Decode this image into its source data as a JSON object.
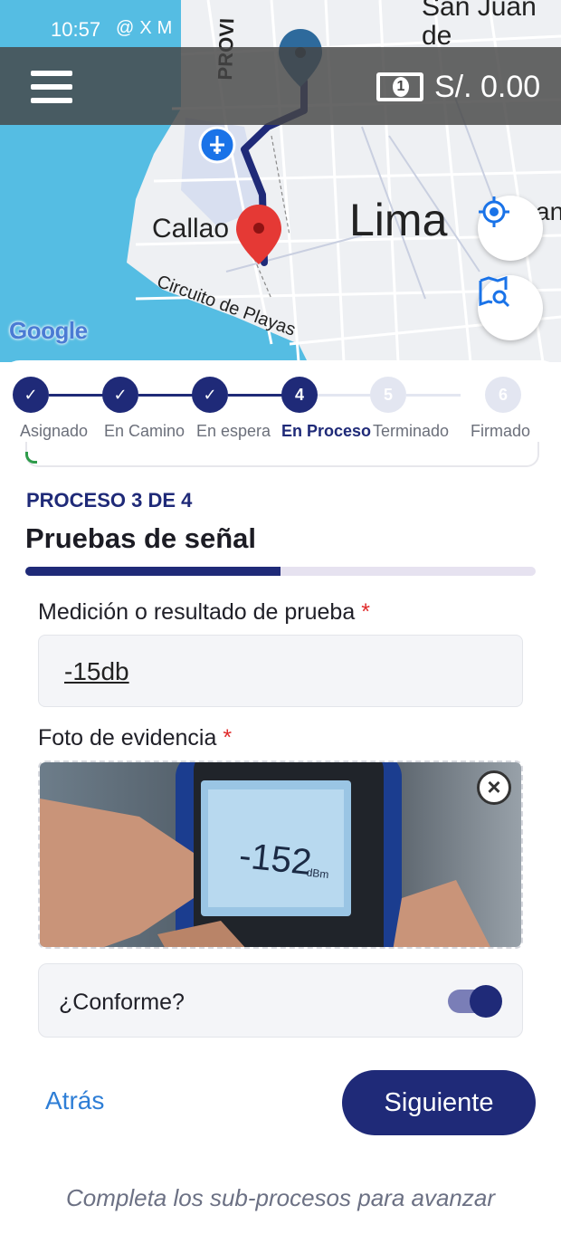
{
  "status_bar": {
    "time": "10:57",
    "icons": [
      "threads-icon",
      "x-icon",
      "gmail-icon"
    ]
  },
  "header": {
    "menu_icon": "hamburger-menu-icon",
    "balance": "S/. 0.00",
    "balance_icon": "banknote-icon"
  },
  "map": {
    "labels": {
      "city": "Lima",
      "port": "Callao",
      "road": "Circuito de Playas",
      "district_top": "San Juan de Lurigancho",
      "street_top": "PROVI",
      "right_edge": "an"
    },
    "attribution": "Google",
    "markers": [
      "origin-pin",
      "destination-pin",
      "airport-marker"
    ],
    "controls": [
      "my-location-button",
      "map-search-button"
    ]
  },
  "stepper": {
    "current": 4,
    "steps": [
      {
        "number": "1",
        "label": "Asignado",
        "state": "done"
      },
      {
        "number": "2",
        "label": "En Camino",
        "state": "done"
      },
      {
        "number": "3",
        "label": "En espera",
        "state": "done"
      },
      {
        "number": "4",
        "label": "En Proceso",
        "state": "active"
      },
      {
        "number": "5",
        "label": "Terminado",
        "state": "todo"
      },
      {
        "number": "6",
        "label": "Firmado",
        "state": "todo"
      }
    ]
  },
  "process": {
    "counter": "PROCESO 3 DE 4",
    "title": "Pruebas de señal",
    "progress_fraction": 0.5
  },
  "form": {
    "measure_label": "Medición o resultado de prueba",
    "measure_required": "*",
    "measure_value": "-15db",
    "photo_label": "Foto de evidencia",
    "photo_required": "*",
    "photo_reading": "-152",
    "photo_unit": "dBm",
    "conforme_label": "¿Conforme?",
    "conforme_checked": true
  },
  "actions": {
    "back_label": "Atrás",
    "next_label": "Siguiente"
  },
  "hint": "Completa los sub-procesos para avanzar",
  "colors": {
    "primary": "#1f2a78",
    "link": "#2e7ed6",
    "required": "#e02b2b",
    "inactive_step": "#e3e6f1"
  }
}
